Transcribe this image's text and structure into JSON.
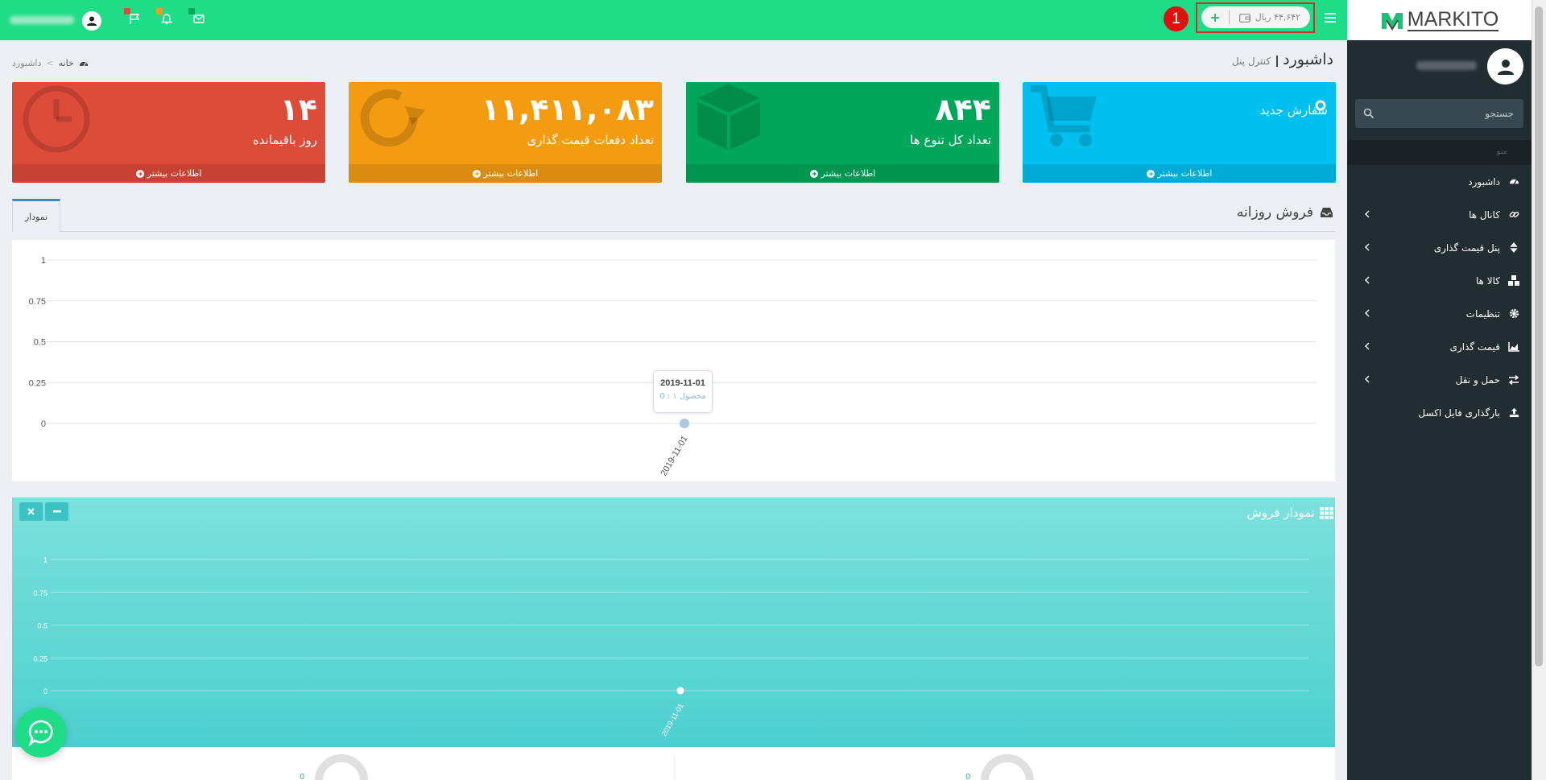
{
  "topbar": {
    "wallet_amount": "۴۴,۶۴۲ ریال",
    "wallet_add": "+",
    "step_number": "1",
    "colors": {
      "bar": "#1fdd87",
      "highlight": "#d32f2f"
    },
    "icons": [
      "bars-icon",
      "wallet-icon",
      "envelope-icon",
      "bell-icon",
      "flag-icon",
      "user-icon"
    ]
  },
  "sidebar": {
    "logo_text": "MARKITO",
    "search_placeholder": "جستجو",
    "menu_header": "منو",
    "items": [
      {
        "label": "داشبورد",
        "icon": "dashboard-icon",
        "has_children": false
      },
      {
        "label": "کانال ها",
        "icon": "link-icon",
        "has_children": true
      },
      {
        "label": "پنل قیمت گذاری",
        "icon": "sort-icon",
        "has_children": true
      },
      {
        "label": "کالا ها",
        "icon": "cubes-icon",
        "has_children": true
      },
      {
        "label": "تنظیمات",
        "icon": "gear-icon",
        "has_children": true
      },
      {
        "label": "قیمت گذاری",
        "icon": "area-chart-icon",
        "has_children": true
      },
      {
        "label": "حمل و نقل",
        "icon": "exchange-icon",
        "has_children": true
      },
      {
        "label": "بارگذاری فایل اکسل",
        "icon": "upload-icon",
        "has_children": false
      }
    ]
  },
  "header": {
    "title": "داشبورد",
    "subtitle": "کنترل پنل",
    "breadcrumb": [
      "خانه",
      "داشبورد"
    ]
  },
  "boxes": [
    {
      "value": "",
      "label": "سفارش جدید",
      "more": "اطلاعات بیشتر",
      "color": "#00c0ef",
      "icon": "shopping-cart-icon"
    },
    {
      "value": "۸۴۴",
      "label": "تعداد کل تنوع ها",
      "more": "اطلاعات بیشتر",
      "color": "#00a65a",
      "icon": "cube-icon"
    },
    {
      "value": "۱۱,۴۱۱,۰۸۳",
      "label": "تعداد دفعات قیمت گذاری",
      "more": "اطلاعات بیشتر",
      "color": "#f39c12",
      "icon": "refresh-icon"
    },
    {
      "value": "۱۴",
      "label": "روز باقیمانده",
      "more": "اطلاعات بیشتر",
      "color": "#dd4b39",
      "icon": "clock-icon"
    }
  ],
  "daily_sales": {
    "title": "فروش روزانه",
    "tab": "نمودار",
    "tooltip": {
      "title": "2019-11-01",
      "value": "محصول ۱ : 0"
    }
  },
  "sales_chart": {
    "title": "نمودار فروش"
  },
  "bottom": {
    "knob_left_value": "0",
    "knob_right_value": "0"
  },
  "chart_data": [
    {
      "type": "line",
      "title": "",
      "x": [
        "2019-11-01"
      ],
      "series": [
        {
          "name": "محصول ۱",
          "values": [
            0
          ]
        }
      ],
      "y_ticks": [
        "0",
        "0.25",
        "0.5",
        "0.75",
        "1"
      ],
      "ylim": [
        0,
        1
      ],
      "grid": true
    },
    {
      "type": "line",
      "title": "",
      "x": [
        "2019-11-01"
      ],
      "series": [
        {
          "values": [
            0
          ]
        }
      ],
      "y_ticks": [
        "0",
        "0.25",
        "0.5",
        "0.75",
        "1"
      ],
      "ylim": [
        0,
        1
      ],
      "grid": true
    }
  ]
}
